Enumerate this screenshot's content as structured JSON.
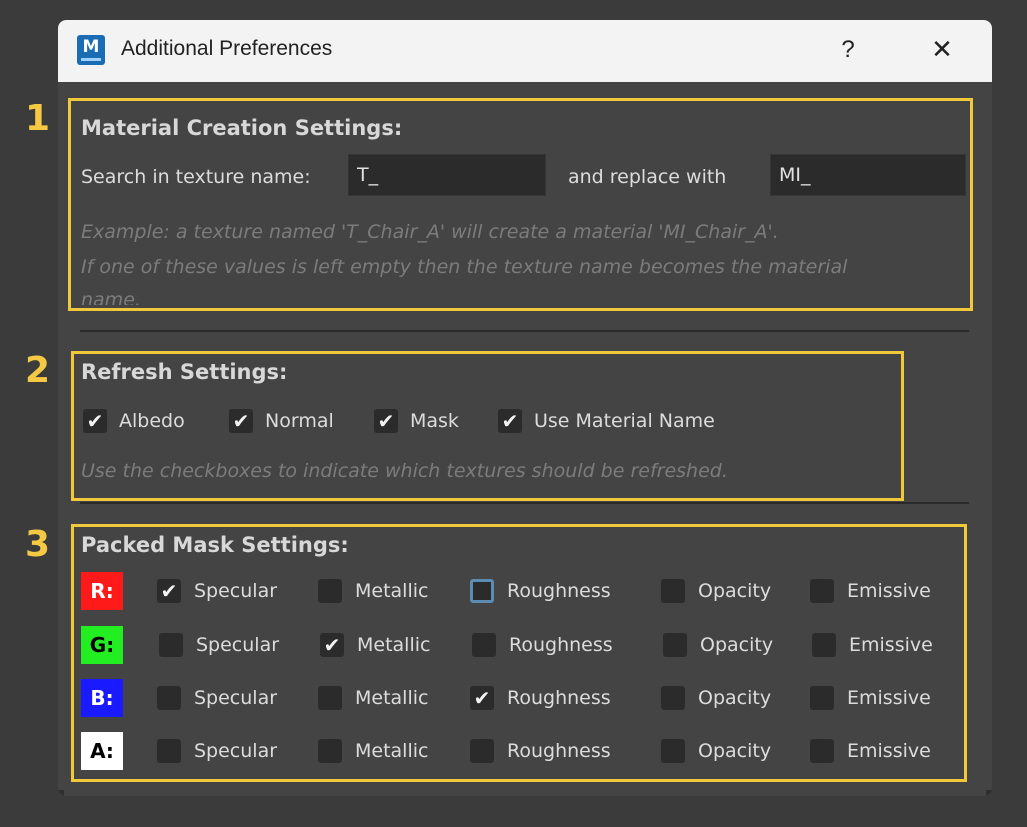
{
  "window": {
    "title": "Additional Preferences",
    "help_label": "?",
    "close_label": "✕",
    "app_icon_letter": "M"
  },
  "section_markers": [
    "1",
    "2",
    "3"
  ],
  "material": {
    "heading": "Material Creation Settings:",
    "search_label": "Search in texture name:",
    "search_value": "T_",
    "replace_label": "and replace with",
    "replace_value": "MI_",
    "hint_line1": "Example: a texture named 'T_Chair_A' will create a material 'MI_Chair_A'.",
    "hint_line2": "If one of these values is left empty then the texture name becomes the material",
    "hint_line3": "name."
  },
  "refresh": {
    "heading": "Refresh Settings:",
    "options": [
      {
        "label": "Albedo",
        "checked": true
      },
      {
        "label": "Normal",
        "checked": true
      },
      {
        "label": "Mask",
        "checked": true
      },
      {
        "label": "Use Material Name",
        "checked": true
      }
    ],
    "hint": "Use the checkboxes to indicate which textures should be refreshed."
  },
  "packed": {
    "heading": "Packed Mask Settings:",
    "columns": [
      "Specular",
      "Metallic",
      "Roughness",
      "Opacity",
      "Emissive"
    ],
    "rows": [
      {
        "channel": "R:",
        "bg": "#ff1a1a",
        "fg": "#ffffff",
        "checked": [
          true,
          false,
          false,
          false,
          false
        ],
        "focused": 2
      },
      {
        "channel": "G:",
        "bg": "#22ee22",
        "fg": "#000000",
        "checked": [
          false,
          true,
          false,
          false,
          false
        ],
        "focused": -1
      },
      {
        "channel": "B:",
        "bg": "#1a1aff",
        "fg": "#ffffff",
        "checked": [
          false,
          false,
          true,
          false,
          false
        ],
        "focused": -1
      },
      {
        "channel": "A:",
        "bg": "#ffffff",
        "fg": "#000000",
        "checked": [
          false,
          false,
          false,
          false,
          false
        ],
        "focused": -1
      }
    ]
  },
  "colors": {
    "highlight": "#f0c93a",
    "marker": "#f6c944",
    "panel": "#444444",
    "background": "#3b3b3b"
  }
}
